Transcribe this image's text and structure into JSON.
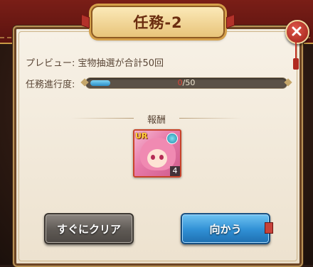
{
  "dialog": {
    "title": "任務-2",
    "close_icon": "close-x-icon"
  },
  "mission": {
    "preview_text": "プレビュー:  宝物抽選が合計50回",
    "progress_label": "任務進行度:",
    "progress_current": "0",
    "progress_total": "/50",
    "progress_value": 0,
    "progress_max": 50
  },
  "reward": {
    "label": "報酬",
    "item": {
      "rarity_badge": "UR",
      "count": "4",
      "element_icon": "water-element-icon"
    }
  },
  "buttons": {
    "clear_now": "すぐにクリア",
    "go": "向かう"
  },
  "colors": {
    "progress_fill": "#2c8fc7",
    "go_button": "#2f8fd4",
    "clear_button": "#5e5954",
    "card_border": "#c8432a"
  }
}
